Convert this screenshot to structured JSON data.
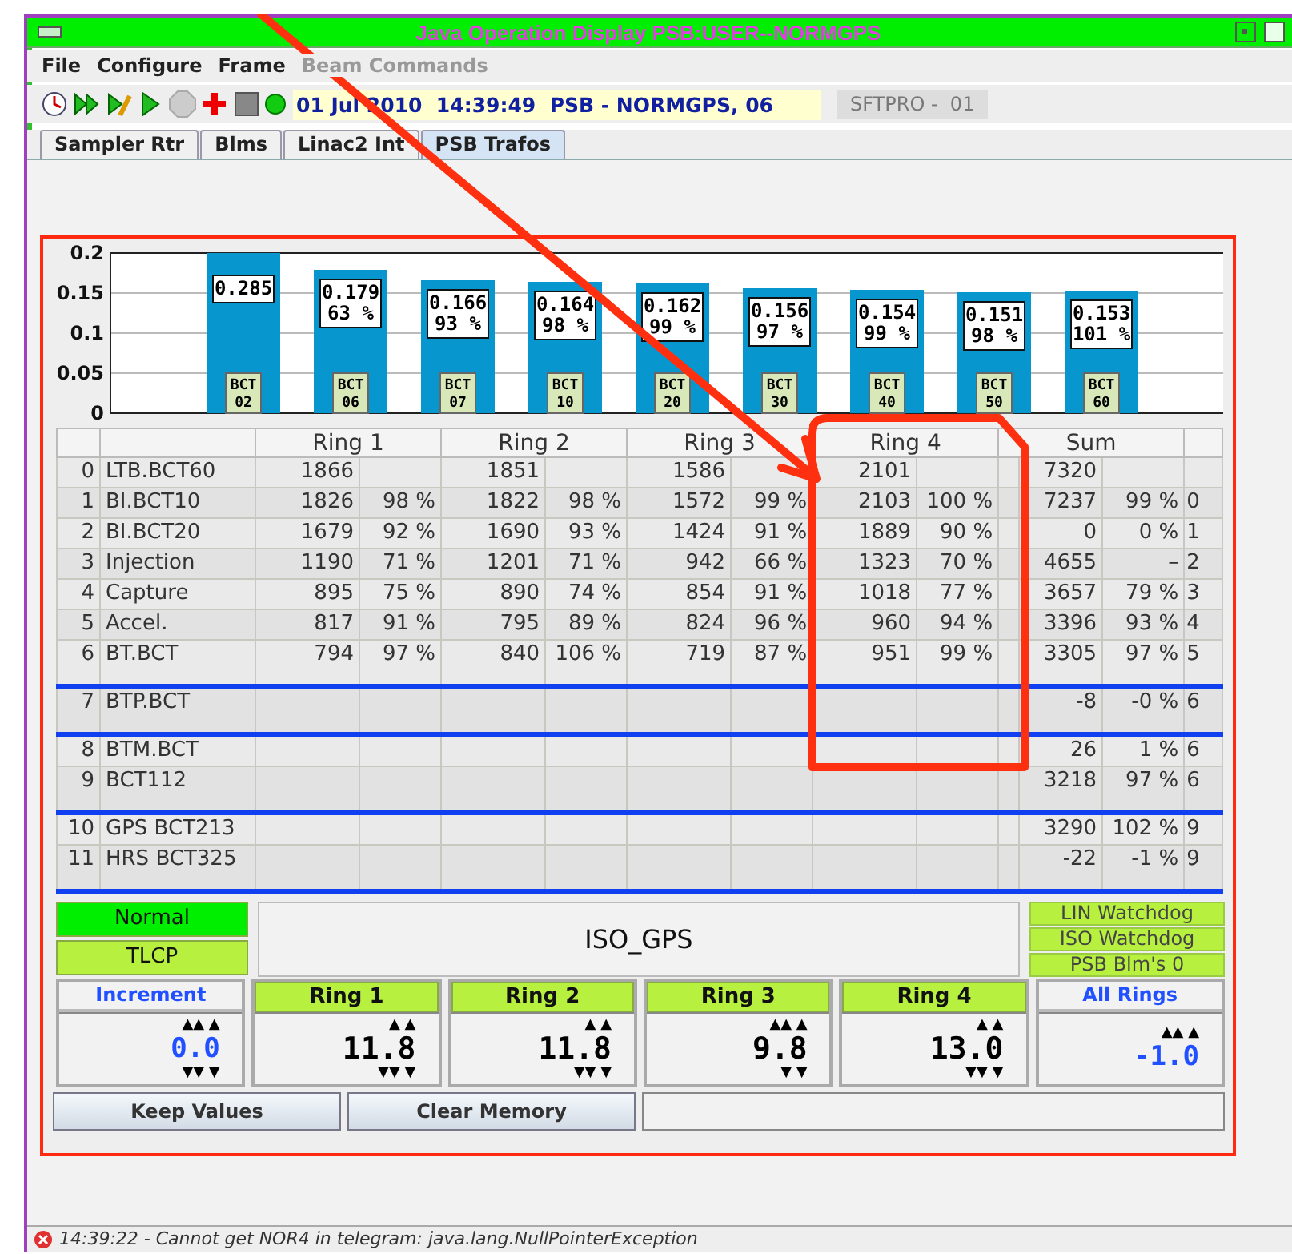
{
  "window": {
    "title": "Java Operation Display PSB:USER--NORMGPS"
  },
  "menu": [
    {
      "label": "File",
      "disabled": false
    },
    {
      "label": "Configure",
      "disabled": false
    },
    {
      "label": "Frame",
      "disabled": false
    },
    {
      "label": "Beam Commands",
      "disabled": true
    }
  ],
  "toolbar": {
    "timestamp": "01 Jul 2010  14:39:49  PSB - NORMGPS, 06",
    "user": "SFTPRO -  01"
  },
  "tabs": [
    {
      "label": "Sampler Rtr",
      "selected": false
    },
    {
      "label": "Blms",
      "selected": false
    },
    {
      "label": "Linac2 Int",
      "selected": false
    },
    {
      "label": "PSB Trafos",
      "selected": true
    }
  ],
  "chart": {
    "chart_data": {
      "type": "bar",
      "categories": [
        "BCT 02",
        "BCT 06",
        "BCT 07",
        "BCT 10",
        "BCT 20",
        "BCT 30",
        "BCT 40",
        "BCT 50",
        "BCT 60"
      ],
      "values": [
        null,
        0.179,
        0.166,
        0.164,
        0.162,
        0.156,
        0.154,
        0.151,
        0.153
      ],
      "value_labels": [
        "0.285",
        "0.179",
        "0.166",
        "0.164",
        "0.162",
        "0.156",
        "0.154",
        "0.151",
        "0.153"
      ],
      "ylim": [
        0,
        0.2
      ],
      "yticks": [
        0,
        0.05,
        0.1,
        0.15,
        0.2
      ],
      "grid": true
    },
    "percent_labels": [
      "63 %",
      "93 %",
      "98 %",
      "99 %",
      "97 %",
      "99 %",
      "98 %",
      "101 %"
    ]
  },
  "table": {
    "columns": [
      "Ring 1",
      "Ring 2",
      "Ring 3",
      "Ring 4",
      "Sum"
    ],
    "groups": [
      {
        "rows": [
          {
            "index": "0",
            "name": "LTB.BCT60",
            "rings": [
              {
                "count": "1866"
              },
              {
                "count": "1851"
              },
              {
                "count": "1586"
              },
              {
                "count": "2101"
              }
            ],
            "sum": {
              "count": "7320"
            }
          },
          {
            "index": "1",
            "name": "BI.BCT10",
            "rings": [
              {
                "count": "1826",
                "percent": "98 %"
              },
              {
                "count": "1822",
                "percent": "98 %"
              },
              {
                "count": "1572",
                "percent": "99 %"
              },
              {
                "count": "2103",
                "percent": "100 %"
              }
            ],
            "sum": {
              "count": "7237",
              "percent": "99 %"
            },
            "column_8": "0"
          },
          {
            "index": "2",
            "name": "BI.BCT20",
            "rings": [
              {
                "count": "1679",
                "percent": "92 %"
              },
              {
                "count": "1690",
                "percent": "93 %"
              },
              {
                "count": "1424",
                "percent": "91 %"
              },
              {
                "count": "1889",
                "percent": "90 %"
              }
            ],
            "sum": {
              "count": "0",
              "percent": "0 %"
            },
            "column_8": "1"
          },
          {
            "index": "3",
            "name": "Injection",
            "rings": [
              {
                "count": "1190",
                "percent": "71 %"
              },
              {
                "count": "1201",
                "percent": "71 %"
              },
              {
                "count": "942",
                "percent": "66 %"
              },
              {
                "count": "1323",
                "percent": "70 %"
              }
            ],
            "sum": {
              "count": "4655",
              "percent": "–"
            },
            "column_8": "2"
          },
          {
            "index": "4",
            "name": "Capture",
            "rings": [
              {
                "count": "895",
                "percent": "75 %"
              },
              {
                "count": "890",
                "percent": "74 %"
              },
              {
                "count": "854",
                "percent": "91 %"
              },
              {
                "count": "1018",
                "percent": "77 %"
              }
            ],
            "sum": {
              "count": "3657",
              "percent": "79 %"
            },
            "column_8": "3"
          },
          {
            "index": "5",
            "name": "Accel.",
            "rings": [
              {
                "count": "817",
                "percent": "91 %"
              },
              {
                "count": "795",
                "percent": "89 %"
              },
              {
                "count": "824",
                "percent": "96 %"
              },
              {
                "count": "960",
                "percent": "94 %"
              }
            ],
            "sum": {
              "count": "3396",
              "percent": "93 %"
            },
            "column_8": "4"
          },
          {
            "index": "6",
            "name": "BT.BCT",
            "rings": [
              {
                "count": "794",
                "percent": "97 %"
              },
              {
                "count": "840",
                "percent": "106 %"
              },
              {
                "count": "719",
                "percent": "87 %"
              },
              {
                "count": "951",
                "percent": "99 %"
              }
            ],
            "sum": {
              "count": "3305",
              "percent": "97 %"
            },
            "column_8": "5"
          }
        ]
      },
      {
        "rows": [
          {
            "index": "7",
            "name": "BTP.BCT",
            "sum": {
              "count": "-8",
              "percent": "-0 %"
            },
            "column_8": "6"
          }
        ]
      },
      {
        "rows": [
          {
            "index": "8",
            "name": "BTM.BCT",
            "sum": {
              "count": "26",
              "percent": "1 %"
            },
            "column_8": "6"
          },
          {
            "index": "9",
            "name": "BCT112",
            "sum": {
              "count": "3218",
              "percent": "97 %"
            },
            "column_8": "6"
          }
        ]
      },
      {
        "rows": [
          {
            "index": "10",
            "name": "GPS BCT213",
            "sum": {
              "count": "3290",
              "percent": "102 %"
            },
            "column_8": "9"
          },
          {
            "index": "11",
            "name": "HRS BCT325",
            "sum": {
              "count": "-22",
              "percent": "-1 %"
            },
            "column_8": "9"
          }
        ]
      }
    ]
  },
  "modes": [
    {
      "label": "Normal",
      "color": "#00ee00"
    },
    {
      "label": "TLCP",
      "color": "#b8f040"
    }
  ],
  "beam": "ISO_GPS",
  "watchdogs": [
    {
      "label": "LIN Watchdog"
    },
    {
      "label": "ISO Watchdog"
    },
    {
      "label": "PSB Blm's 0"
    }
  ],
  "adjusters": [
    {
      "kind": "global",
      "title": "Increment",
      "up": "▲▲ ▲",
      "value": "0.0",
      "down": "▼▼ ▼"
    },
    {
      "kind": "ring",
      "title": "Ring 1",
      "up": "▲ ▲",
      "value": "11.8",
      "down": "▼▼ ▼"
    },
    {
      "kind": "ring",
      "title": "Ring 2",
      "up": "▲ ▲",
      "value": "11.8",
      "down": "▼▼ ▼"
    },
    {
      "kind": "ring",
      "title": "Ring 3",
      "up": "▲▲ ▲",
      "value": "9.8",
      "down": "▼ ▼"
    },
    {
      "kind": "ring",
      "title": "Ring 4",
      "up": "▲ ▲",
      "value": "13.0",
      "down": "▼▼ ▼"
    },
    {
      "kind": "global",
      "title": "All Rings",
      "up": "▲▲ ▲",
      "value": "-1.0"
    }
  ],
  "buttons": [
    "Keep Values",
    "Clear Memory"
  ],
  "status_bar": {
    "message": "14:39:22 - Cannot get NOR4 in telegram: java.lang.NullPointerException"
  }
}
